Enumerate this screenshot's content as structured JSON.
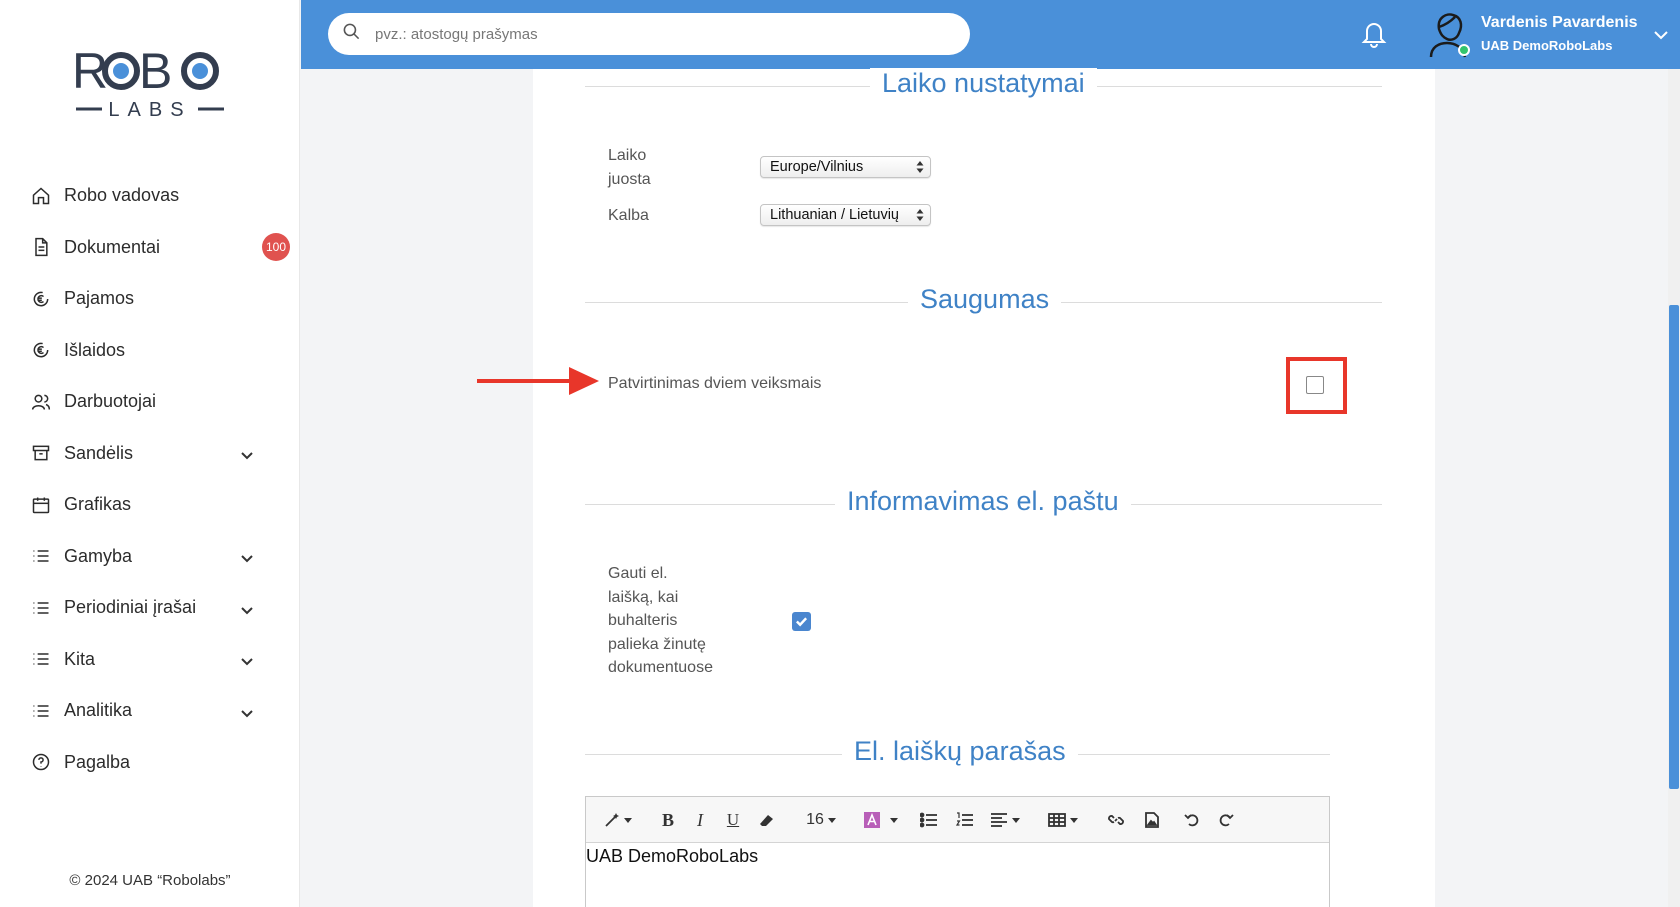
{
  "sidebar": {
    "logo_top": "ROBO",
    "logo_bottom": "LABS",
    "items": [
      {
        "label": "Robo vadovas",
        "icon": "home-icon"
      },
      {
        "label": "Dokumentai",
        "icon": "document-icon",
        "badge": "100"
      },
      {
        "label": "Pajamos",
        "icon": "euro-in-icon"
      },
      {
        "label": "Išlaidos",
        "icon": "euro-out-icon"
      },
      {
        "label": "Darbuotojai",
        "icon": "users-icon"
      },
      {
        "label": "Sandėlis",
        "icon": "archive-icon",
        "expandable": true
      },
      {
        "label": "Grafikas",
        "icon": "calendar-icon"
      },
      {
        "label": "Gamyba",
        "icon": "list-icon",
        "expandable": true
      },
      {
        "label": "Periodiniai įrašai",
        "icon": "list-icon",
        "expandable": true
      },
      {
        "label": "Kita",
        "icon": "list-icon",
        "expandable": true
      },
      {
        "label": "Analitika",
        "icon": "list-icon",
        "expandable": true
      },
      {
        "label": "Pagalba",
        "icon": "help-icon"
      }
    ],
    "copyright": "© 2024 UAB “Robolabs”"
  },
  "header": {
    "search_placeholder": "pvz.: atostogų prašymas",
    "user_name": "Vardenis Pavardenis",
    "company": "UAB DemoRoboLabs"
  },
  "time_settings": {
    "title": "Laiko nustatymai",
    "timezone_label_1": "Laiko",
    "timezone_label_2": "juosta",
    "timezone_value": "Europe/Vilnius",
    "language_label": "Kalba",
    "language_value": "Lithuanian / Lietuvių"
  },
  "security": {
    "title": "Saugumas",
    "two_factor_label": "Patvirtinimas dviem veiksmais",
    "two_factor_enabled": false
  },
  "email_notifications": {
    "title": "Informavimas el. paštu",
    "label_lines": [
      "Gauti el.",
      "laišką, kai",
      "buhalteris",
      "palieka žinutę",
      "dokumentuose"
    ],
    "enabled": true
  },
  "signature": {
    "title": "El. laiškų parašas",
    "font_size": "16",
    "content": "UAB DemoRoboLabs"
  },
  "colors": {
    "brand_blue": "#4a90d9",
    "section_blue": "#3f82c6",
    "highlight_red": "#e8362a",
    "badge_red": "#e0524f"
  }
}
